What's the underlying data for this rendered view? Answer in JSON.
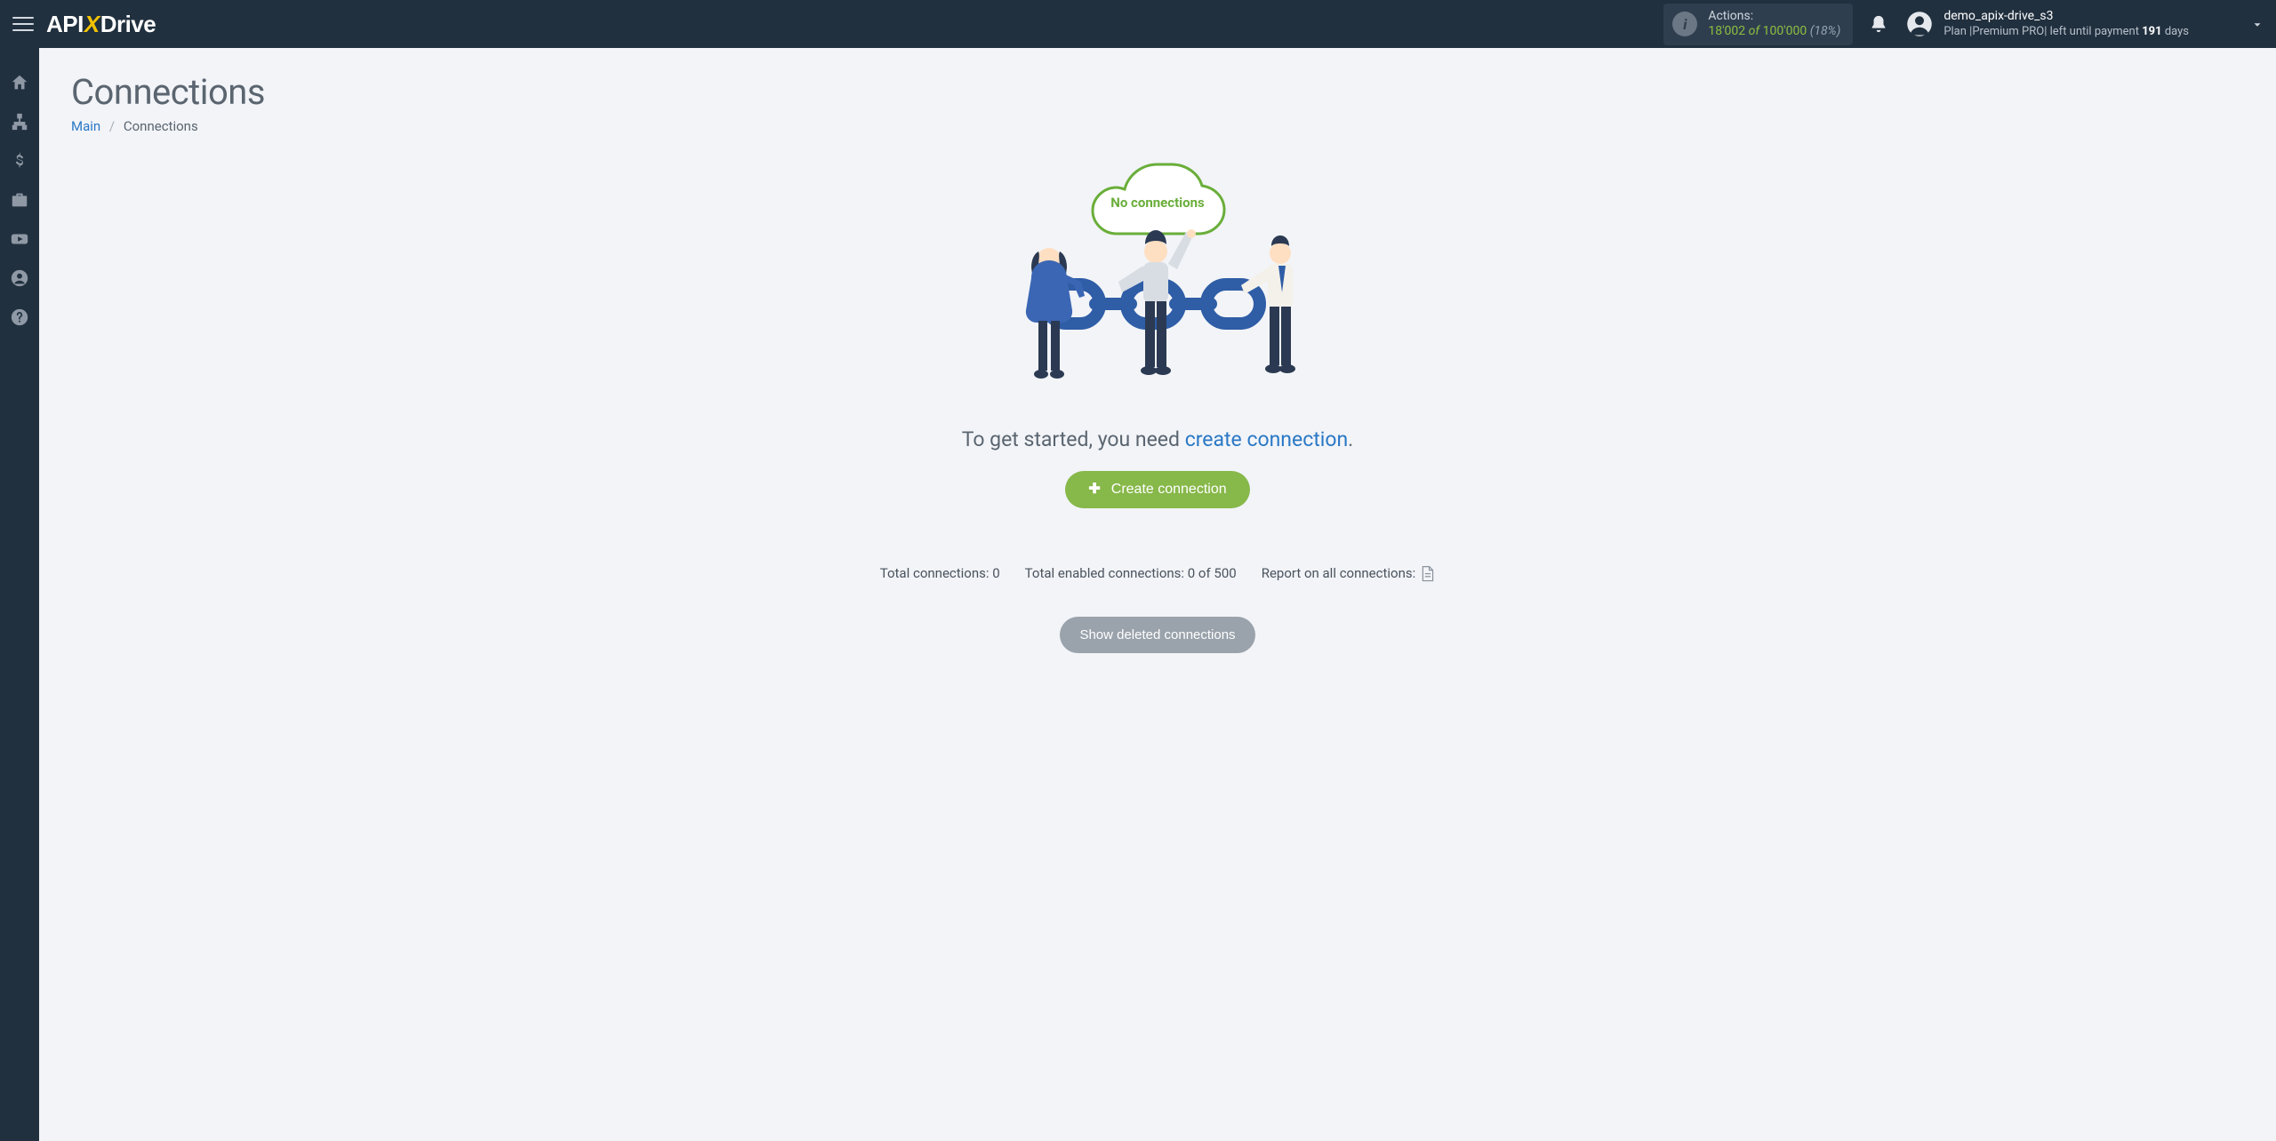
{
  "brand": {
    "api": "API",
    "x": "X",
    "drive": "Drive"
  },
  "actions": {
    "label": "Actions:",
    "count": "18'002",
    "of": "of",
    "total": "100'000",
    "percent": "(18%)"
  },
  "user": {
    "name": "demo_apix-drive_s3",
    "plan_prefix": "Plan |",
    "plan_name": "Premium PRO",
    "plan_mid": "| left until payment ",
    "days": "191",
    "plan_suffix": " days"
  },
  "sidebar": [
    {
      "name": "home-icon"
    },
    {
      "name": "sitemap-icon"
    },
    {
      "name": "dollar-icon"
    },
    {
      "name": "briefcase-icon"
    },
    {
      "name": "youtube-icon"
    },
    {
      "name": "user-icon"
    },
    {
      "name": "help-icon"
    }
  ],
  "page": {
    "title": "Connections",
    "breadcrumbs": {
      "main": "Main",
      "sep": "/",
      "current": "Connections"
    }
  },
  "empty": {
    "cloud_text": "No connections",
    "start_prefix": "To get started, you need ",
    "start_link": "create connection",
    "start_suffix": "."
  },
  "buttons": {
    "create": "Create connection",
    "show_deleted": "Show deleted connections"
  },
  "stats": {
    "total_label": "Total connections: ",
    "total_value": "0",
    "enabled_label": "Total enabled connections: ",
    "enabled_value": "0 of 500",
    "report_label": "Report on all connections:"
  }
}
